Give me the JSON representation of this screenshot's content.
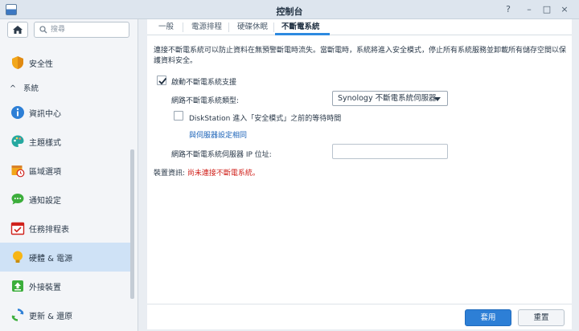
{
  "window": {
    "title": "控制台",
    "controls": [
      "?",
      "–",
      "□",
      "×"
    ]
  },
  "sidebar": {
    "search_placeholder": "搜尋",
    "items": [
      {
        "label": "安全性",
        "icon": "shield-icon"
      },
      {
        "label": "資訊中心",
        "icon": "info-icon"
      },
      {
        "label": "主題樣式",
        "icon": "palette-icon"
      },
      {
        "label": "區域選項",
        "icon": "calendar-clock-icon"
      },
      {
        "label": "通知設定",
        "icon": "chat-icon"
      },
      {
        "label": "任務排程表",
        "icon": "task-calendar-icon"
      },
      {
        "label": "硬體 & 電源",
        "icon": "bulb-icon",
        "active": true
      },
      {
        "label": "外接裝置",
        "icon": "upload-icon"
      },
      {
        "label": "更新 & 還原",
        "icon": "refresh-icon"
      }
    ],
    "section_label": "系統",
    "section_chevron": "^"
  },
  "tabs": [
    {
      "label": "一般"
    },
    {
      "label": "電源排程"
    },
    {
      "label": "硬碟休眠"
    },
    {
      "label": "不斷電系統",
      "active": true
    }
  ],
  "ups": {
    "description": "連接不斷電系統可以防止資料在無預警斷電時流失。當斷電時，系統將進入安全模式，停止所有系統服務並卸載所有儲存空間以保護資料安全。",
    "enable_label": "啟動不斷電系統支援",
    "enable_checked": true,
    "type_label": "網路不斷電系統類型:",
    "type_value": "Synology 不斷電系統伺服器",
    "wait_label": "DiskStation 進入「安全模式」之前的等待時間",
    "wait_checked": false,
    "same_as_server_link": "與伺服器設定相同",
    "server_ip_label": "網路不斷電系統伺服器 IP 位址:",
    "server_ip_value": "",
    "device_info_label": "裝置資訊:",
    "device_info_status": "尚未連接不斷電系統。"
  },
  "footer": {
    "apply_label": "套用",
    "reset_label": "重置"
  },
  "colors": {
    "accent": "#2d7fd6",
    "active_nav_bg": "#cfe2f6",
    "status_red": "#d0221c"
  }
}
